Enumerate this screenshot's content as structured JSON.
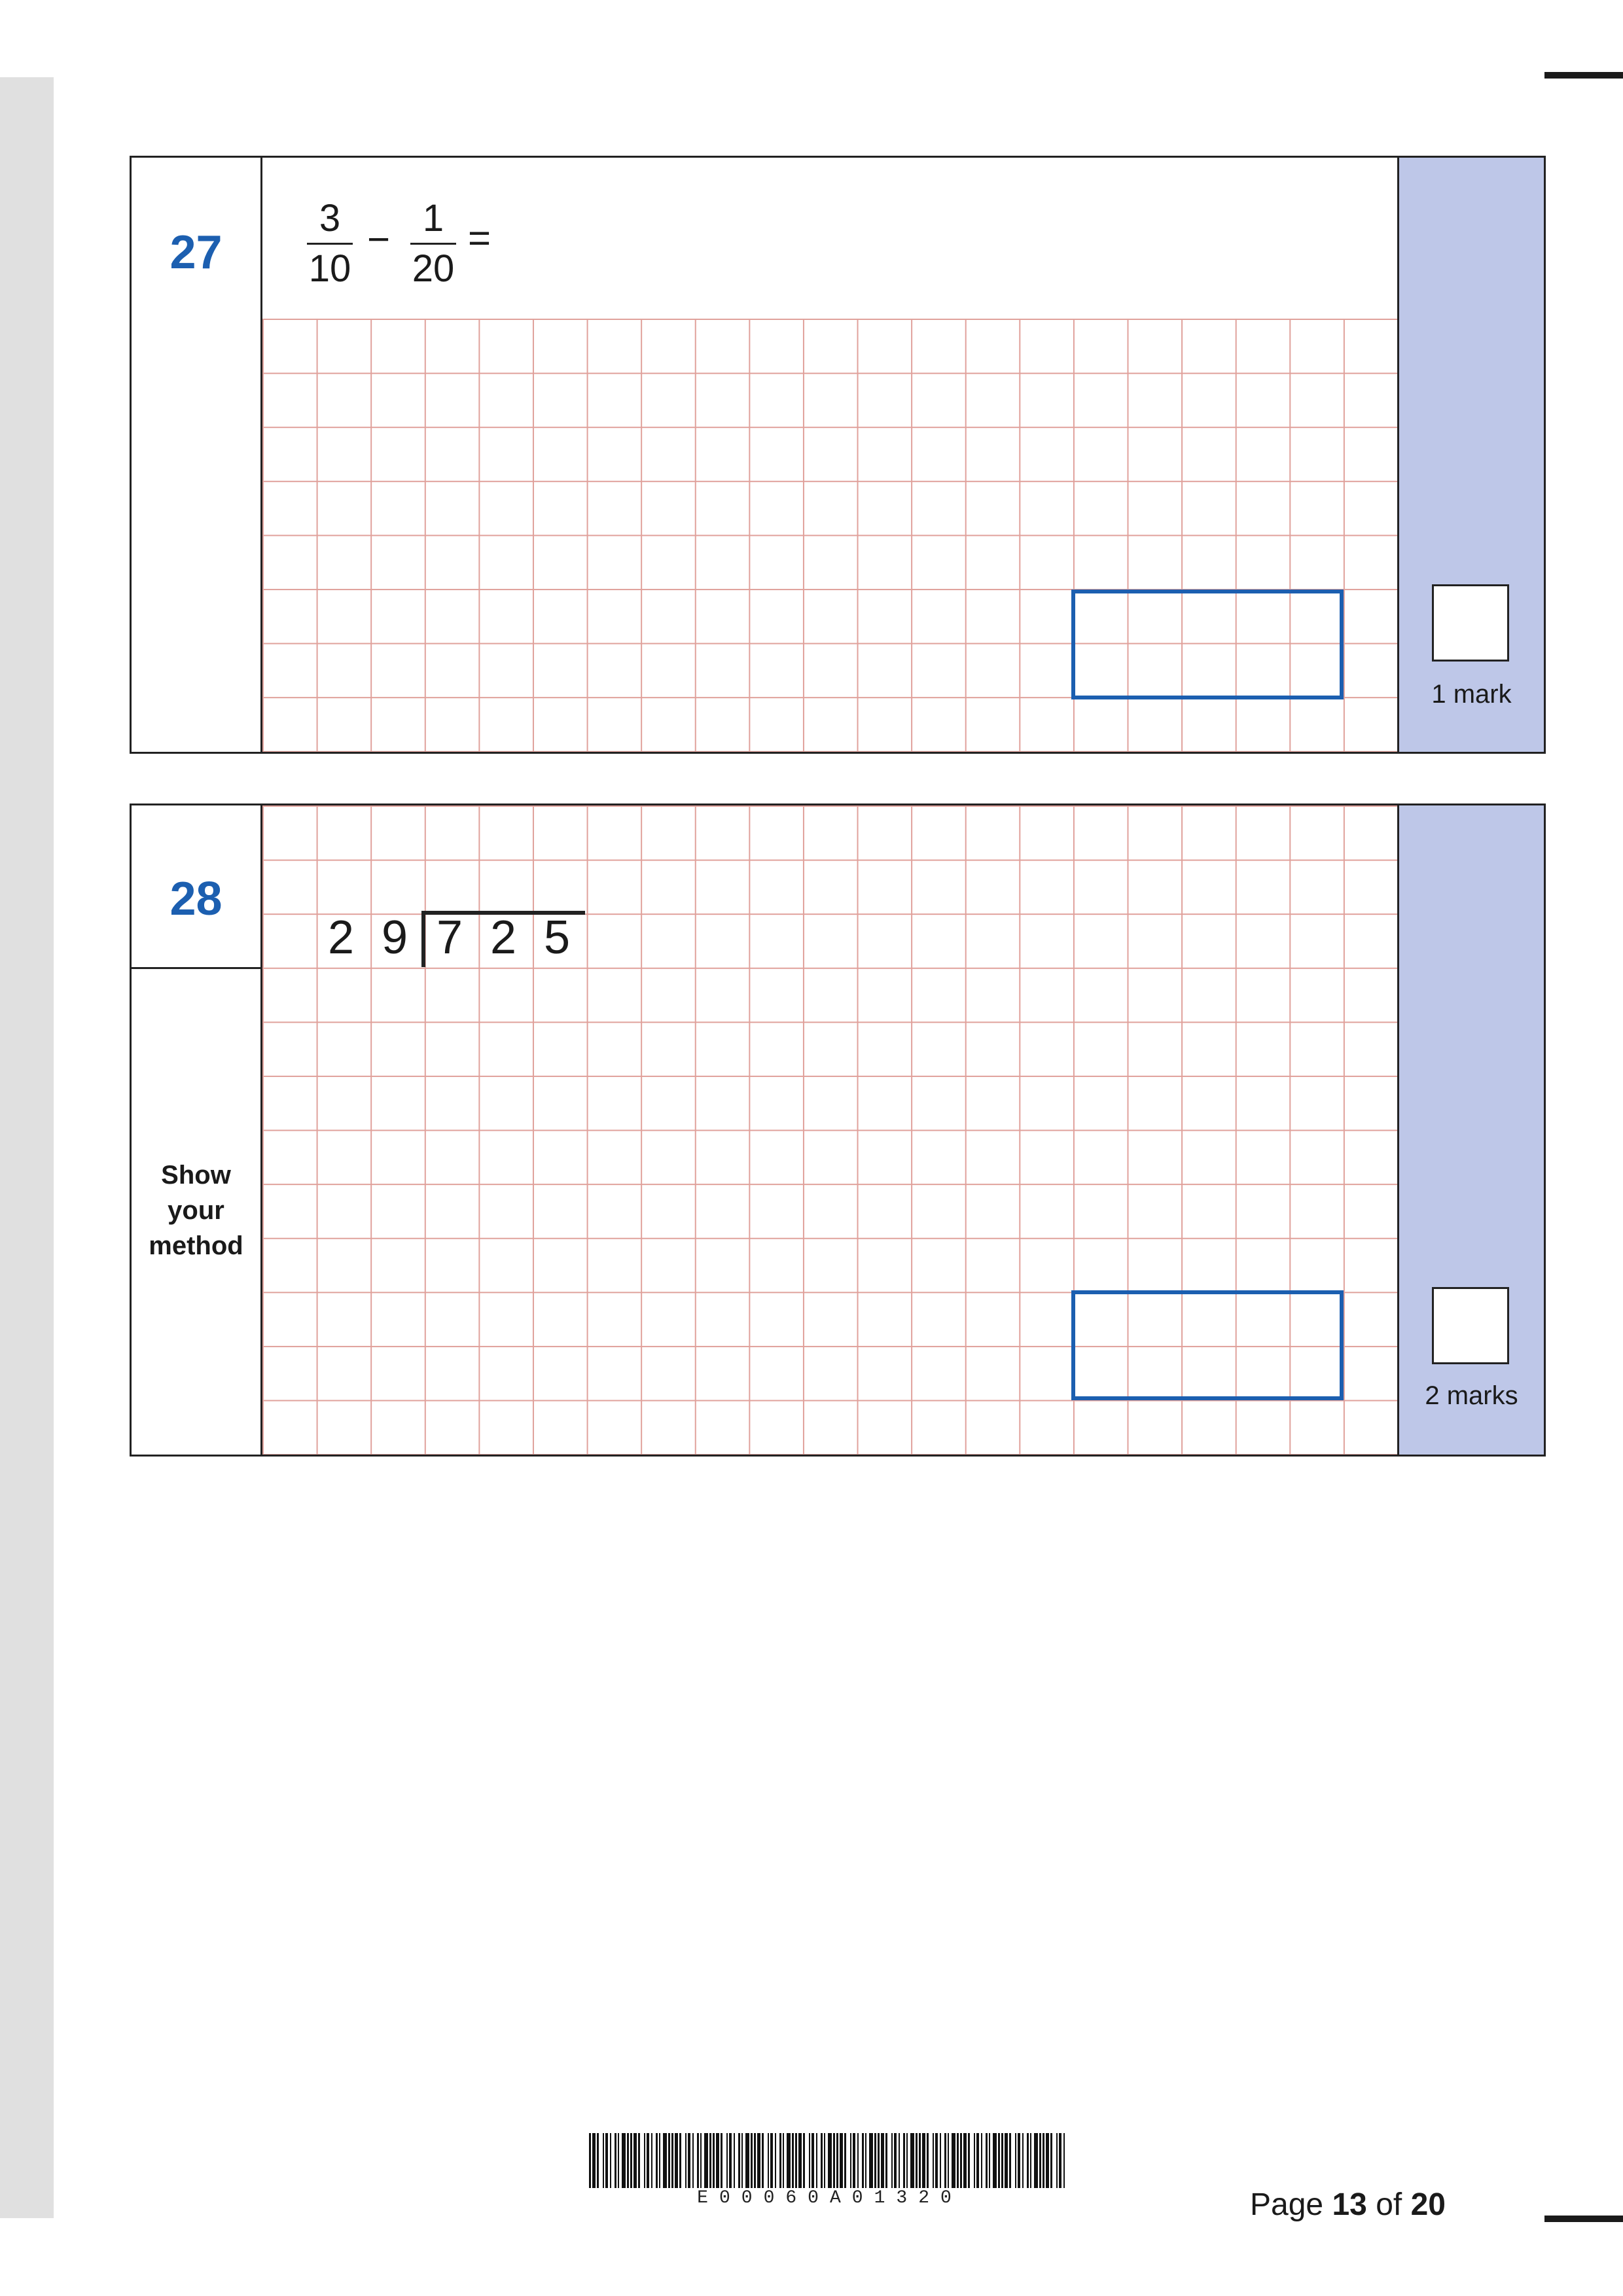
{
  "questions": [
    {
      "number": "27",
      "expression": {
        "fraction_1": {
          "numerator": "3",
          "denominator": "10"
        },
        "operator": "−",
        "fraction_2": {
          "numerator": "1",
          "denominator": "20"
        },
        "equals": "="
      },
      "marks_label": "1 mark"
    },
    {
      "number": "28",
      "division": {
        "divisor_digits": [
          "2",
          "9"
        ],
        "dividend_digits": [
          "7",
          "2",
          "5"
        ]
      },
      "prompt_lines": [
        "Show",
        "your",
        "method"
      ],
      "marks_label": "2 marks"
    }
  ],
  "footer": {
    "barcode_text": "E00060A01320",
    "page_prefix": "Page",
    "page_current": "13",
    "page_of": "of",
    "page_total": "20"
  },
  "colors": {
    "question_number": "#1c5fb0",
    "answer_box_border": "#1c5fb0",
    "marks_column": "#bec7e8",
    "grid_lines": "#e0a19b",
    "margin_gutter": "#e0e0e0"
  }
}
